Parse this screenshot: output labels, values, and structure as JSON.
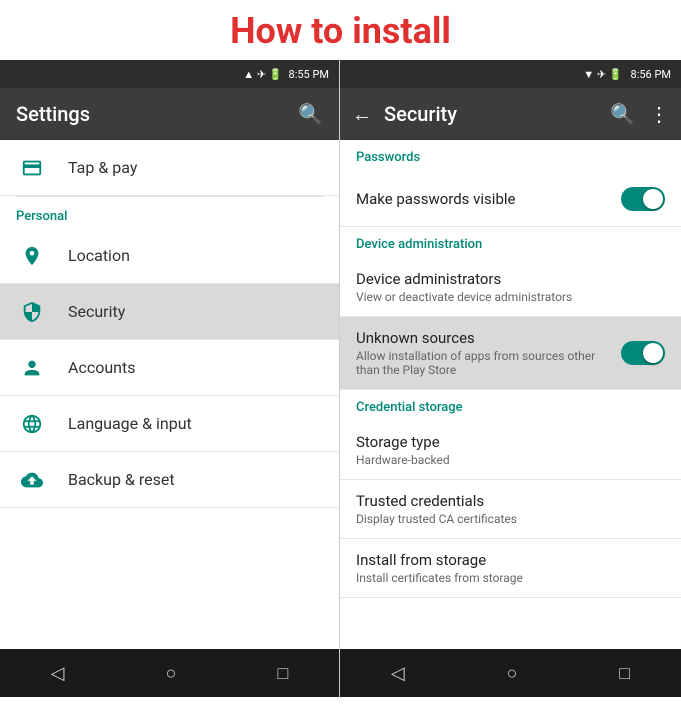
{
  "title": "How to install",
  "left": {
    "statusbar": {
      "time": "8:55 PM",
      "icons": [
        "signal",
        "wifi",
        "battery"
      ]
    },
    "toolbar": {
      "title": "Settings",
      "search_icon": "🔍"
    },
    "items": [
      {
        "id": "tap-pay",
        "icon": "tap-icon",
        "icon_char": "📳",
        "label": "Tap & pay",
        "highlighted": false
      }
    ],
    "section_personal": "Personal",
    "personal_items": [
      {
        "id": "location",
        "icon": "location-icon",
        "label": "Location",
        "highlighted": false
      },
      {
        "id": "security",
        "icon": "security-icon",
        "label": "Security",
        "highlighted": true
      },
      {
        "id": "accounts",
        "icon": "accounts-icon",
        "label": "Accounts",
        "highlighted": false
      },
      {
        "id": "language",
        "icon": "language-icon",
        "label": "Language & input",
        "highlighted": false
      },
      {
        "id": "backup",
        "icon": "backup-icon",
        "label": "Backup & reset",
        "highlighted": false
      }
    ],
    "navbar": {
      "back": "◁",
      "home": "○",
      "recent": "□"
    }
  },
  "right": {
    "statusbar": {
      "time": "8:56 PM",
      "icons": [
        "wifi",
        "arrow",
        "battery"
      ]
    },
    "toolbar": {
      "back_icon": "←",
      "title": "Security",
      "search_icon": "🔍",
      "more_icon": "⋮"
    },
    "sections": [
      {
        "header": "Passwords",
        "items": [
          {
            "id": "make-passwords",
            "title": "Make passwords visible",
            "subtitle": "",
            "has_toggle": true,
            "toggle_on": true,
            "highlighted": false
          }
        ]
      },
      {
        "header": "Device administration",
        "items": [
          {
            "id": "device-admins",
            "title": "Device administrators",
            "subtitle": "View or deactivate device administrators",
            "has_toggle": false,
            "highlighted": false
          },
          {
            "id": "unknown-sources",
            "title": "Unknown sources",
            "subtitle": "Allow installation of apps from sources other than the Play Store",
            "has_toggle": true,
            "toggle_on": true,
            "highlighted": true
          }
        ]
      },
      {
        "header": "Credential storage",
        "items": [
          {
            "id": "storage-type",
            "title": "Storage type",
            "subtitle": "Hardware-backed",
            "has_toggle": false,
            "highlighted": false
          },
          {
            "id": "trusted-credentials",
            "title": "Trusted credentials",
            "subtitle": "Display trusted CA certificates",
            "has_toggle": false,
            "highlighted": false
          },
          {
            "id": "install-from-storage",
            "title": "Install from storage",
            "subtitle": "Install certificates from storage",
            "has_toggle": false,
            "highlighted": false
          }
        ]
      }
    ],
    "navbar": {
      "back": "◁",
      "home": "○",
      "recent": "□"
    }
  }
}
